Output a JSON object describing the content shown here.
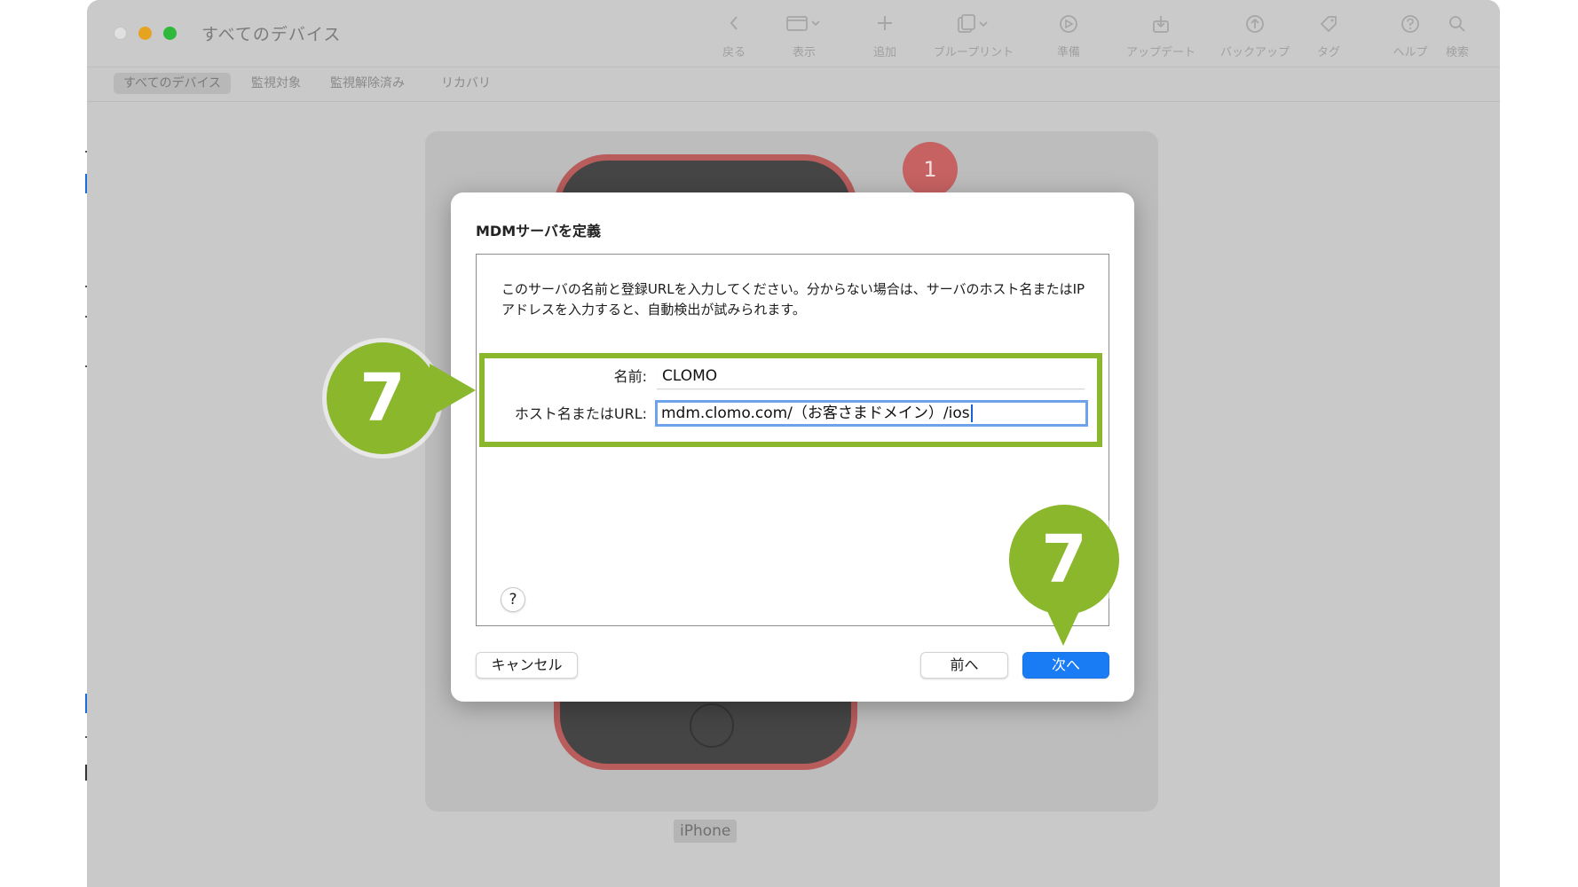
{
  "window": {
    "title": "すべてのデバイス"
  },
  "toolbar": {
    "back": {
      "label": "戻る",
      "icon": "chevron-left-icon"
    },
    "view": {
      "label": "表示",
      "icon": "window-view-icon"
    },
    "add": {
      "label": "追加",
      "icon": "plus-icon"
    },
    "blueprint": {
      "label": "ブループリント",
      "icon": "blueprint-icon"
    },
    "prepare": {
      "label": "準備",
      "icon": "prepare-icon"
    },
    "update": {
      "label": "アップデート",
      "icon": "download-tray-icon"
    },
    "backup": {
      "label": "バックアップ",
      "icon": "upload-circle-icon"
    },
    "tag": {
      "label": "タグ",
      "icon": "tag-icon"
    },
    "help": {
      "label": "ヘルプ",
      "icon": "question-circle-icon"
    },
    "search": {
      "label": "検索",
      "icon": "magnifier-icon"
    }
  },
  "tabs": [
    {
      "label": "すべてのデバイス",
      "active": true
    },
    {
      "label": "監視対象",
      "active": false
    },
    {
      "label": "監視解除済み",
      "active": false
    },
    {
      "label": "リカバリ",
      "active": false
    }
  ],
  "device": {
    "label": "iPhone",
    "badge": "1"
  },
  "dialog": {
    "title": "MDMサーバを定義",
    "description": "このサーバの名前と登録URLを入力してください。分からない場合は、サーバのホスト名またはIPアドレスを入力すると、自動検出が試みられます。",
    "name_label": "名前:",
    "name_value": "CLOMO",
    "host_label": "ホスト名またはURL:",
    "host_value": "mdm.clomo.com/（お客さまドメイン）/ios",
    "help_label": "?",
    "cancel_label": "キャンセル",
    "back_label": "前へ",
    "next_label": "次へ"
  },
  "callouts": {
    "left": "7",
    "right": "7"
  },
  "colors": {
    "accent_blue": "#1a7cf5",
    "callout_green": "#8ab72c",
    "badge_red": "#c66262"
  }
}
